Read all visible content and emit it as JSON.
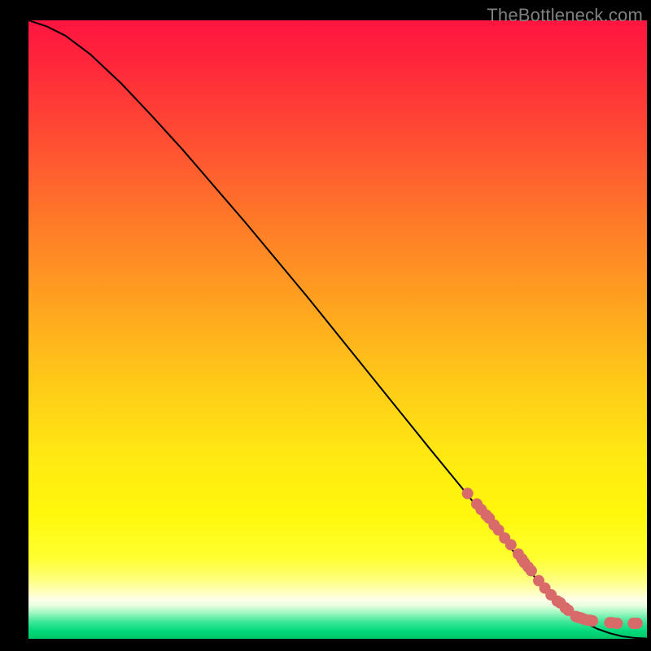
{
  "watermark": "TheBottleneck.com",
  "chart_data": {
    "type": "line",
    "title": "",
    "xlabel": "",
    "ylabel": "",
    "xlim": [
      0,
      100
    ],
    "ylim": [
      0,
      100
    ],
    "curve": {
      "name": "performance-curve",
      "x": [
        0,
        3,
        6,
        10,
        15,
        20,
        25,
        30,
        35,
        40,
        45,
        50,
        55,
        60,
        65,
        70,
        75,
        80,
        82,
        84,
        86,
        88,
        90,
        92,
        94,
        96,
        98,
        100
      ],
      "y": [
        100,
        99,
        97.5,
        94.5,
        89.8,
        84.5,
        79.0,
        73.2,
        67.4,
        61.4,
        55.4,
        49.2,
        43.0,
        36.8,
        30.6,
        24.5,
        18.3,
        12.2,
        9.8,
        7.6,
        5.5,
        3.9,
        2.6,
        1.6,
        0.9,
        0.4,
        0.15,
        0.05
      ]
    },
    "markers": {
      "name": "data-points",
      "x": [
        71.0,
        72.5,
        73.2,
        74.0,
        74.5,
        75.3,
        76.0,
        77.0,
        78.0,
        79.2,
        79.8,
        80.2,
        80.8,
        81.3,
        82.5,
        83.5,
        84.5,
        85.5,
        86.0,
        86.8,
        87.3,
        88.5,
        88.8,
        89.2,
        89.5,
        90.0,
        90.5,
        90.8,
        91.2,
        94.0,
        94.4,
        95.2,
        97.8,
        98.4
      ],
      "y": [
        23.5,
        21.8,
        20.9,
        20.0,
        19.5,
        18.4,
        17.6,
        16.3,
        15.2,
        13.7,
        12.9,
        12.3,
        11.6,
        11.0,
        9.4,
        8.2,
        7.1,
        6.1,
        5.8,
        5.0,
        4.6,
        3.6,
        3.5,
        3.4,
        3.3,
        3.1,
        3.0,
        3.0,
        2.9,
        2.6,
        2.6,
        2.5,
        2.5,
        2.5
      ],
      "color": "#d96a6a",
      "radius": 7
    },
    "gradient_stops": [
      {
        "offset": 0.0,
        "color": "#ff1440"
      },
      {
        "offset": 0.08,
        "color": "#ff2a3a"
      },
      {
        "offset": 0.2,
        "color": "#ff5032"
      },
      {
        "offset": 0.32,
        "color": "#ff7828"
      },
      {
        "offset": 0.45,
        "color": "#ffa020"
      },
      {
        "offset": 0.58,
        "color": "#ffc818"
      },
      {
        "offset": 0.7,
        "color": "#ffe812"
      },
      {
        "offset": 0.8,
        "color": "#fff80c"
      },
      {
        "offset": 0.87,
        "color": "#ffff30"
      },
      {
        "offset": 0.905,
        "color": "#ffff80"
      },
      {
        "offset": 0.925,
        "color": "#ffffc0"
      },
      {
        "offset": 0.937,
        "color": "#fcffe8"
      },
      {
        "offset": 0.946,
        "color": "#e8ffe0"
      },
      {
        "offset": 0.958,
        "color": "#a0f8c0"
      },
      {
        "offset": 0.972,
        "color": "#40e898"
      },
      {
        "offset": 0.988,
        "color": "#00d878"
      },
      {
        "offset": 1.0,
        "color": "#00c868"
      }
    ]
  }
}
